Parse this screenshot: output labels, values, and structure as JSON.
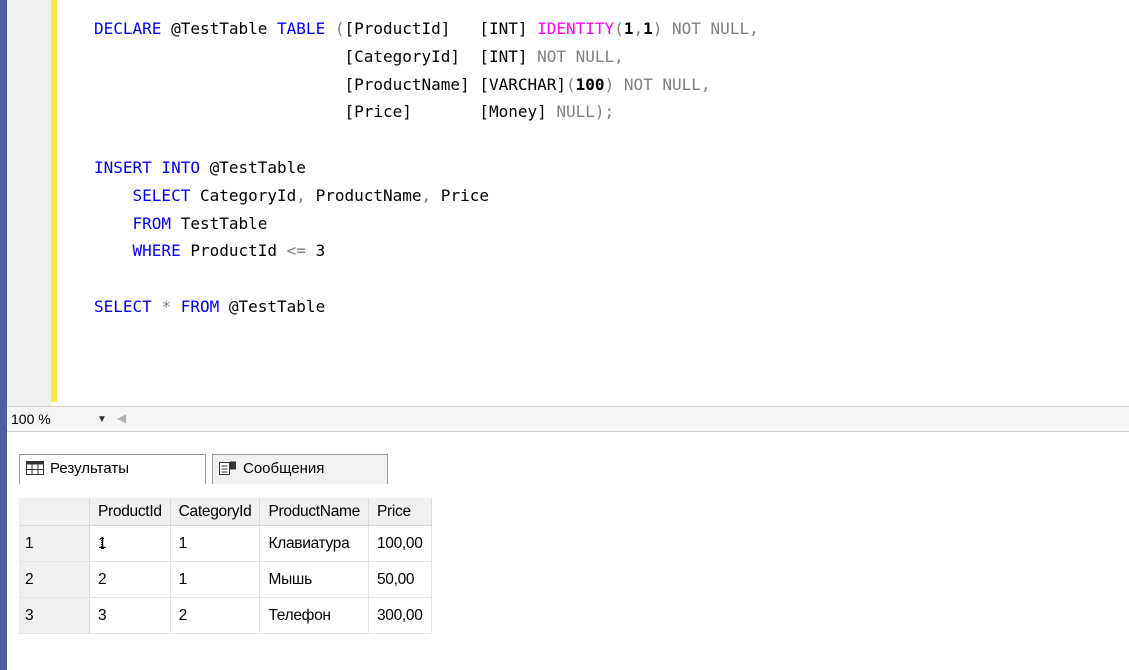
{
  "editor": {
    "code_lines": [
      [
        [
          "DECLARE",
          "kw"
        ],
        [
          " @TestTable ",
          "nm"
        ],
        [
          "TABLE",
          "kw"
        ],
        [
          " (",
          "gr"
        ],
        [
          "[ProductId]   [INT] ",
          "nm"
        ],
        [
          "IDENTITY",
          "fn"
        ],
        [
          "(",
          "gr"
        ],
        [
          "1",
          "num"
        ],
        [
          ",",
          "gr"
        ],
        [
          "1",
          "num"
        ],
        [
          ") ",
          "gr"
        ],
        [
          "NOT NULL",
          "gr"
        ],
        [
          ",",
          "gr"
        ]
      ],
      [
        [
          "                          ",
          "nm"
        ],
        [
          "[CategoryId]  [INT] ",
          "nm"
        ],
        [
          "NOT NULL",
          "gr"
        ],
        [
          ",",
          "gr"
        ]
      ],
      [
        [
          "                          ",
          "nm"
        ],
        [
          "[ProductName] [VARCHAR]",
          "nm"
        ],
        [
          "(",
          "gr"
        ],
        [
          "100",
          "num"
        ],
        [
          ") ",
          "gr"
        ],
        [
          "NOT NULL",
          "gr"
        ],
        [
          ",",
          "gr"
        ]
      ],
      [
        [
          "                          ",
          "nm"
        ],
        [
          "[Price]       [Money] ",
          "nm"
        ],
        [
          "NULL",
          "gr"
        ],
        [
          ");",
          "gr"
        ]
      ],
      [
        [
          "",
          ""
        ]
      ],
      [
        [
          "INSERT INTO",
          "kw"
        ],
        [
          " @TestTable",
          "nm"
        ]
      ],
      [
        [
          "    ",
          "nm"
        ],
        [
          "SELECT",
          "kw"
        ],
        [
          " CategoryId",
          "nm"
        ],
        [
          ",",
          "gr"
        ],
        [
          " ProductName",
          "nm"
        ],
        [
          ",",
          "gr"
        ],
        [
          " Price",
          "nm"
        ]
      ],
      [
        [
          "    ",
          "nm"
        ],
        [
          "FROM",
          "kw"
        ],
        [
          " TestTable",
          "nm"
        ]
      ],
      [
        [
          "    ",
          "nm"
        ],
        [
          "WHERE",
          "kw"
        ],
        [
          " ProductId ",
          "nm"
        ],
        [
          "<=",
          "gr"
        ],
        [
          " 3",
          "nm"
        ]
      ],
      [
        [
          "",
          ""
        ]
      ],
      [
        [
          "SELECT",
          "kw"
        ],
        [
          " * ",
          "gr"
        ],
        [
          "FROM",
          "kw"
        ],
        [
          " @TestTable",
          "nm"
        ]
      ]
    ]
  },
  "zoom": {
    "level": "100 %"
  },
  "tabs": {
    "results": "Результаты",
    "messages": "Сообщения"
  },
  "grid": {
    "columns": [
      "ProductId",
      "CategoryId",
      "ProductName",
      "Price"
    ],
    "rows": [
      {
        "num": "1",
        "cells": [
          "1",
          "1",
          "Клавиатура",
          "100,00"
        ]
      },
      {
        "num": "2",
        "cells": [
          "2",
          "1",
          "Мышь",
          "50,00"
        ]
      },
      {
        "num": "3",
        "cells": [
          "3",
          "2",
          "Телефон",
          "300,00"
        ]
      }
    ]
  }
}
